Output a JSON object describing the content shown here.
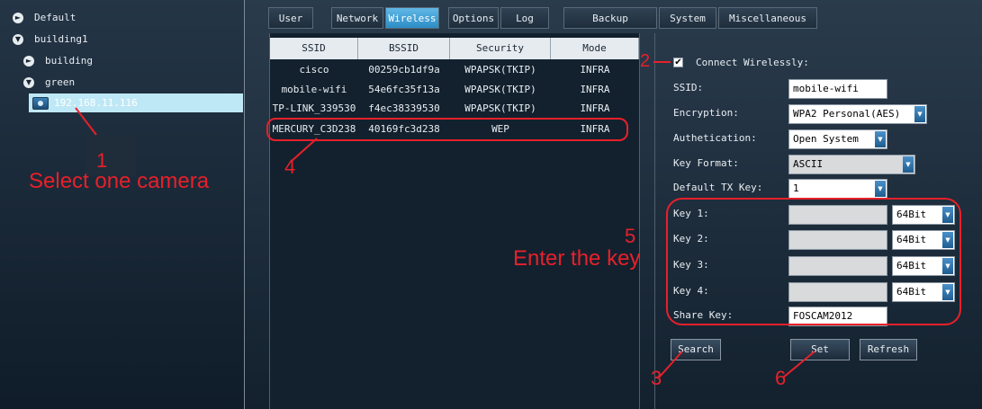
{
  "tree": {
    "items": [
      {
        "label": "Default",
        "toggle": "►"
      },
      {
        "label": "building1",
        "toggle": "▼"
      },
      {
        "label": "building",
        "toggle": "►"
      },
      {
        "label": "green",
        "toggle": "▼"
      }
    ],
    "camera_label": "192.168.11.116"
  },
  "tabs": [
    "User",
    "Network",
    "Wireless",
    "Options",
    "Log",
    "Backup",
    "System",
    "Miscellaneous"
  ],
  "active_tab": "Wireless",
  "networks": {
    "headers": [
      "SSID",
      "BSSID",
      "Security",
      "Mode"
    ],
    "rows": [
      [
        "cisco",
        "00259cb1df9a",
        "WPAPSK(TKIP)",
        "INFRA"
      ],
      [
        "mobile-wifi",
        "54e6fc35f13a",
        "WPAPSK(TKIP)",
        "INFRA"
      ],
      [
        "TP-LINK_339530",
        "f4ec38339530",
        "WPAPSK(TKIP)",
        "INFRA"
      ],
      [
        "MERCURY_C3D238",
        "40169fc3d238",
        "WEP",
        "INFRA"
      ]
    ]
  },
  "settings": {
    "connect_label": "Connect Wirelessly:",
    "connect_checked": "✔",
    "ssid_label": "SSID:",
    "ssid_value": "mobile-wifi",
    "encryption_label": "Encryption:",
    "encryption_value": "WPA2 Personal(AES)",
    "auth_label": "Authetication:",
    "auth_value": "Open System",
    "key_format_label": "Key Format:",
    "key_format_value": "ASCII",
    "default_tx_label": "Default TX Key:",
    "default_tx_value": "1",
    "keys": [
      {
        "label": "Key 1:",
        "value": "",
        "bits": "64Bit"
      },
      {
        "label": "Key 2:",
        "value": "",
        "bits": "64Bit"
      },
      {
        "label": "Key 3:",
        "value": "",
        "bits": "64Bit"
      },
      {
        "label": "Key 4:",
        "value": "",
        "bits": "64Bit"
      }
    ],
    "share_key_label": "Share Key:",
    "share_key_value": "FOSCAM2012",
    "search_button": "Search",
    "set_button": "Set",
    "refresh_button": "Refresh"
  },
  "annotations": {
    "n1": "1",
    "select_camera": "Select one camera",
    "n2": "2",
    "n3": "3",
    "n4": "4",
    "n5": "5",
    "enter_key": "Enter the key",
    "n6": "6"
  },
  "colors": {
    "annotation": "#e8202a",
    "tab_active": "#2c8dc6",
    "selected_row": "#bfe8f6"
  },
  "icons": {
    "collapsed": "chevron-right-icon",
    "expanded": "chevron-down-icon",
    "camera": "camera-icon",
    "dropdown": "dropdown-arrow-icon",
    "checkbox": "checkmark-icon"
  }
}
